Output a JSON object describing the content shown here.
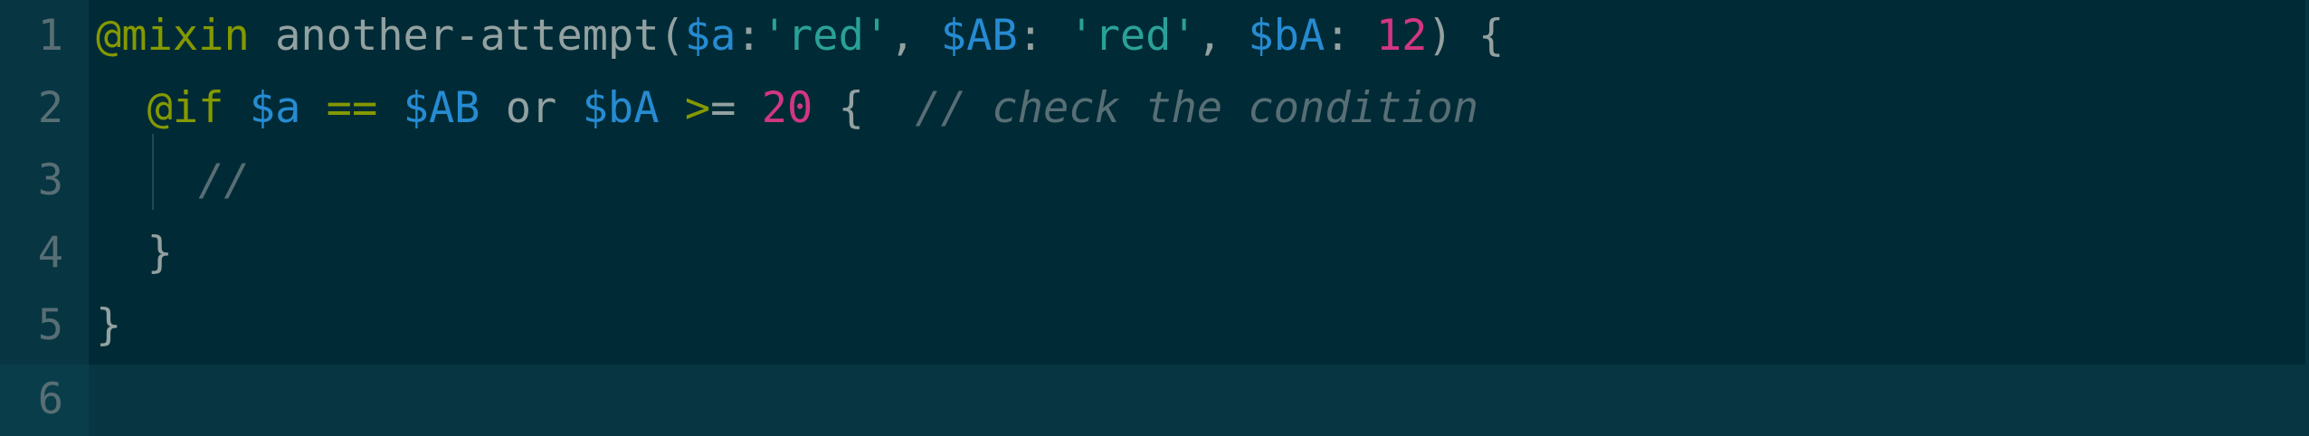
{
  "editor": {
    "line_numbers": [
      "1",
      "2",
      "3",
      "4",
      "5",
      "6"
    ],
    "lines": [
      {
        "tokens": [
          {
            "text": "@mixin",
            "kind": "kw"
          },
          {
            "text": " another-attempt(",
            "kind": "txt"
          },
          {
            "text": "$a",
            "kind": "var"
          },
          {
            "text": ":",
            "kind": "txt"
          },
          {
            "text": "'red'",
            "kind": "str"
          },
          {
            "text": ", ",
            "kind": "txt"
          },
          {
            "text": "$AB",
            "kind": "var"
          },
          {
            "text": ": ",
            "kind": "txt"
          },
          {
            "text": "'red'",
            "kind": "str"
          },
          {
            "text": ", ",
            "kind": "txt"
          },
          {
            "text": "$bA",
            "kind": "var"
          },
          {
            "text": ": ",
            "kind": "txt"
          },
          {
            "text": "12",
            "kind": "num"
          },
          {
            "text": ") {",
            "kind": "txt"
          }
        ]
      },
      {
        "tokens": [
          {
            "text": "  ",
            "kind": "txt"
          },
          {
            "text": "@if",
            "kind": "kw"
          },
          {
            "text": " ",
            "kind": "txt"
          },
          {
            "text": "$a",
            "kind": "var"
          },
          {
            "text": " ",
            "kind": "txt"
          },
          {
            "text": "==",
            "kind": "kw"
          },
          {
            "text": " ",
            "kind": "txt"
          },
          {
            "text": "$AB",
            "kind": "var"
          },
          {
            "text": " or ",
            "kind": "txt"
          },
          {
            "text": "$bA",
            "kind": "var"
          },
          {
            "text": " ",
            "kind": "txt"
          },
          {
            "text": ">",
            "kind": "kw"
          },
          {
            "text": "= ",
            "kind": "txt"
          },
          {
            "text": "20",
            "kind": "num"
          },
          {
            "text": " {  ",
            "kind": "txt"
          },
          {
            "text": "// check the condition",
            "kind": "cmt"
          }
        ]
      },
      {
        "tokens": [
          {
            "text": "    ",
            "kind": "txt"
          },
          {
            "text": "//",
            "kind": "cmt"
          }
        ]
      },
      {
        "tokens": [
          {
            "text": "  }",
            "kind": "txt"
          }
        ]
      },
      {
        "tokens": [
          {
            "text": "}",
            "kind": "txt"
          }
        ]
      },
      {
        "tokens": []
      }
    ]
  },
  "colors": {
    "background": "#002b36",
    "keyword": "#859900",
    "variable": "#268bd2",
    "string": "#2aa198",
    "number": "#d33682",
    "text": "#93a1a1",
    "comment": "#586e75"
  }
}
